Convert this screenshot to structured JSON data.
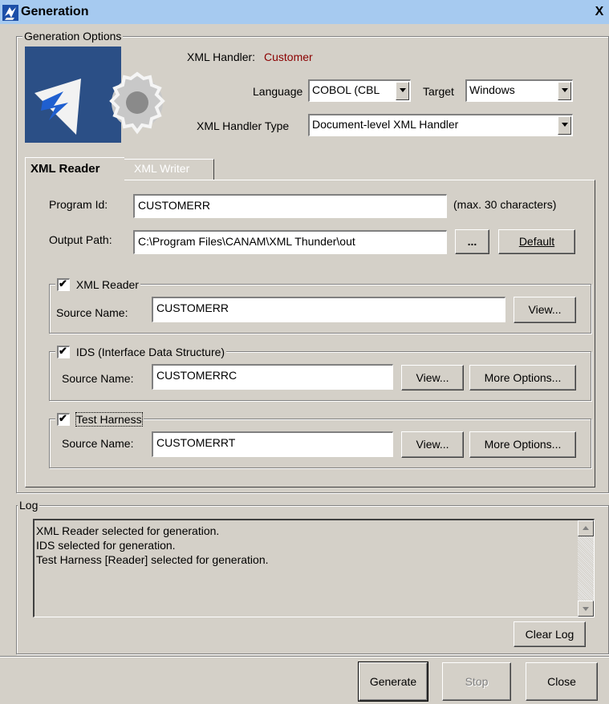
{
  "window": {
    "title": "Generation",
    "close_symbol": "X"
  },
  "options": {
    "group_label": "Generation Options",
    "xml_handler_label": "XML Handler:",
    "xml_handler_value": "Customer",
    "xml_handler_color": "#8b0000",
    "language_label": "Language",
    "language_value": "COBOL (CBL",
    "target_label": "Target",
    "target_value": "Windows",
    "handler_type_label": "XML Handler Type",
    "handler_type_value": "Document-level XML Handler"
  },
  "tabs": [
    {
      "label": "XML Reader",
      "active": true
    },
    {
      "label": "XML Writer",
      "active": false
    }
  ],
  "reader": {
    "program_id_label": "Program Id:",
    "program_id_value": "CUSTOMERR",
    "program_id_hint": "(max. 30 characters)",
    "output_path_label": "Output Path:",
    "output_path_value": "C:\\Program Files\\CANAM\\XML Thunder\\out",
    "browse_label": "...",
    "default_label": "Default",
    "sections": [
      {
        "title": "XML Reader",
        "checked": true,
        "source_label": "Source Name:",
        "source_value": "CUSTOMERR",
        "view_label": "View..."
      },
      {
        "title": "IDS (Interface Data Structure)",
        "checked": true,
        "source_label": "Source Name:",
        "source_value": "CUSTOMERRC",
        "view_label": "View...",
        "more_label": "More Options..."
      },
      {
        "title": "Test Harness",
        "checked": true,
        "source_label": "Source Name:",
        "source_value": "CUSTOMERRT",
        "view_label": "View...",
        "more_label": "More Options..."
      }
    ]
  },
  "log": {
    "group_label": "Log",
    "lines": [
      "XML Reader selected for generation.",
      "IDS selected for generation.",
      "Test Harness [Reader] selected for generation."
    ],
    "clear_label": "Clear Log"
  },
  "footer": {
    "generate_label": "Generate",
    "stop_label": "Stop",
    "close_label": "Close"
  }
}
